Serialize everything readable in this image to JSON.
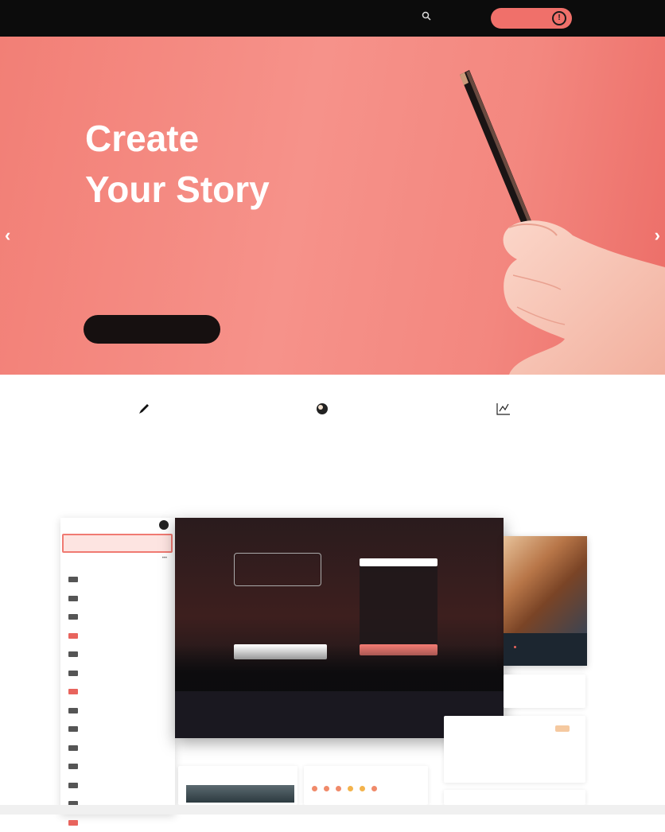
{
  "nav": {
    "logo": "",
    "links": [
      "",
      "",
      "",
      "",
      "",
      "",
      ""
    ],
    "cta_label": ""
  },
  "hero": {
    "title_line1": "Create",
    "title_line2": "Your Story",
    "body": "",
    "button_label": ""
  },
  "features": [
    {
      "icon": "pen-icon",
      "title": "",
      "desc": ""
    },
    {
      "icon": "audience-icon",
      "title": "",
      "desc": ""
    },
    {
      "icon": "analytics-icon",
      "title": "",
      "desc": ""
    }
  ],
  "dashboard": {
    "sidebar": {
      "brand": "",
      "items": [
        "",
        "",
        "",
        "",
        "",
        "",
        "",
        "",
        "",
        "",
        "",
        "",
        "",
        ""
      ]
    },
    "main": {
      "title": "",
      "frame_text": "",
      "subtitle": "",
      "input_placeholder": "",
      "phone_text": ""
    },
    "cards": {
      "card1_label": "",
      "card2_label": "",
      "card3_label": "",
      "card4_label": ""
    }
  },
  "colors": {
    "accent": "#f0706a",
    "nav_bg": "#0c0c0c",
    "hero_bg": "#f48a82"
  }
}
